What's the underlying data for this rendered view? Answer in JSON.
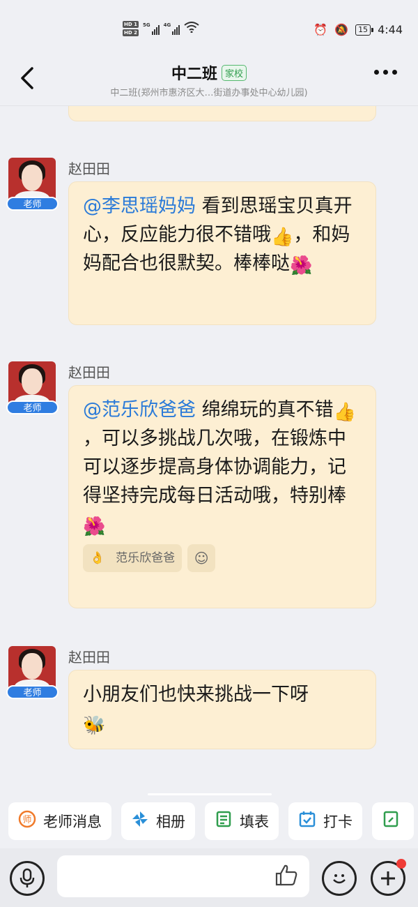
{
  "status_bar": {
    "hd1": "HD 1",
    "hd2": "HD 2",
    "net1": "5G",
    "net2": "4G",
    "battery": "15",
    "time": "4:44"
  },
  "header": {
    "title": "中二班",
    "tag": "家校",
    "subtitle": "中二班(郑州市惠济区大…街道办事处中心幼儿园)"
  },
  "messages": [
    {
      "sender": "赵田田",
      "role": "老师",
      "mention": "@李思瑶妈妈",
      "text1": " 看到思瑶宝贝真开心，反应能力很不错哦",
      "emoji1": "👍",
      "text2": "，和妈妈配合也很默契。棒棒哒",
      "emoji2": "🌺"
    },
    {
      "sender": "赵田田",
      "role": "老师",
      "mention": "@范乐欣爸爸",
      "text1": " 绵绵玩的真不错",
      "emoji1": "👍",
      "text2": "，可以多挑战几次哦，在锻炼中可以逐步提高身体协调能力，记得坚持完成每日活动哦，特别棒",
      "emoji2": "🌺",
      "reaction_emoji": "👌",
      "reaction_user": "范乐欣爸爸",
      "reaction_add_icon": "emoji-plus-icon"
    },
    {
      "sender": "赵田田",
      "role": "老师",
      "text1": "小朋友们也快来挑战一下呀",
      "emoji1": "🐝"
    }
  ],
  "toolbar": [
    {
      "label": "老师消息",
      "icon": "teacher-icon"
    },
    {
      "label": "相册",
      "icon": "pinwheel-icon"
    },
    {
      "label": "填表",
      "icon": "form-icon"
    },
    {
      "label": "打卡",
      "icon": "checkin-icon"
    },
    {
      "label": "",
      "icon": "notice-icon"
    }
  ],
  "colors": {
    "bubble": "#fdefd3",
    "mention": "#2a7ad8",
    "role_badge": "#2f7de1",
    "tag_green": "#2f9d4d"
  }
}
